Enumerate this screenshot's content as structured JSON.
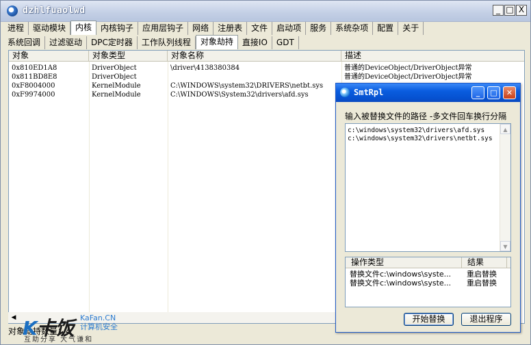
{
  "window": {
    "title": "dzhlfuaolwd",
    "min": "_",
    "max": "□",
    "close": "X"
  },
  "tabs_top": [
    "进程",
    "驱动模块",
    "内核",
    "内核钩子",
    "应用层钩子",
    "网络",
    "注册表",
    "文件",
    "启动项",
    "服务",
    "系统杂项",
    "配置",
    "关于"
  ],
  "tabs_top_active": 2,
  "tabs_sub": [
    "系统回调",
    "过滤驱动",
    "DPC定时器",
    "工作队列线程",
    "对象劫持",
    "直接IO",
    "GDT"
  ],
  "tabs_sub_active": 4,
  "list": {
    "columns": [
      "对象",
      "对象类型",
      "对象名称",
      "描述"
    ],
    "rows": [
      [
        "0x810ED1A8",
        "DriverObject",
        "\\driver\\4138380384",
        "普通的DeviceObject/DriverObject异常"
      ],
      [
        "0x811BD8E8",
        "DriverObject",
        "",
        "普通的DeviceObject/DriverObject异常"
      ],
      [
        "0xF8004000",
        "KernelModule",
        "C:\\WINDOWS\\system32\\DRIVERS\\netbt.sys",
        ""
      ],
      [
        "0xF9974000",
        "KernelModule",
        "C:\\WINDOWS\\System32\\drivers\\afd.sys",
        ""
      ]
    ]
  },
  "status": "对象劫持数量：4",
  "watermark": {
    "logo": "卡饭",
    "site": "KaFan.CN",
    "tag": "计算机安全",
    "sub": "互助分享  大气谦和"
  },
  "dialog": {
    "title": "SmtRpl",
    "prompt": "输入被替换文件的路径 -多文件回车换行分隔",
    "lines": [
      "c:\\windows\\system32\\drivers\\afd.sys",
      "c:\\windows\\system32\\drivers\\netbt.sys"
    ],
    "list_columns": [
      "操作类型",
      "结果"
    ],
    "list_rows": [
      [
        "替换文件c:\\windows\\syste...",
        "重启替换"
      ],
      [
        "替换文件c:\\windows\\syste...",
        "重启替换"
      ]
    ],
    "btn_start": "开始替换",
    "btn_exit": "退出程序"
  }
}
